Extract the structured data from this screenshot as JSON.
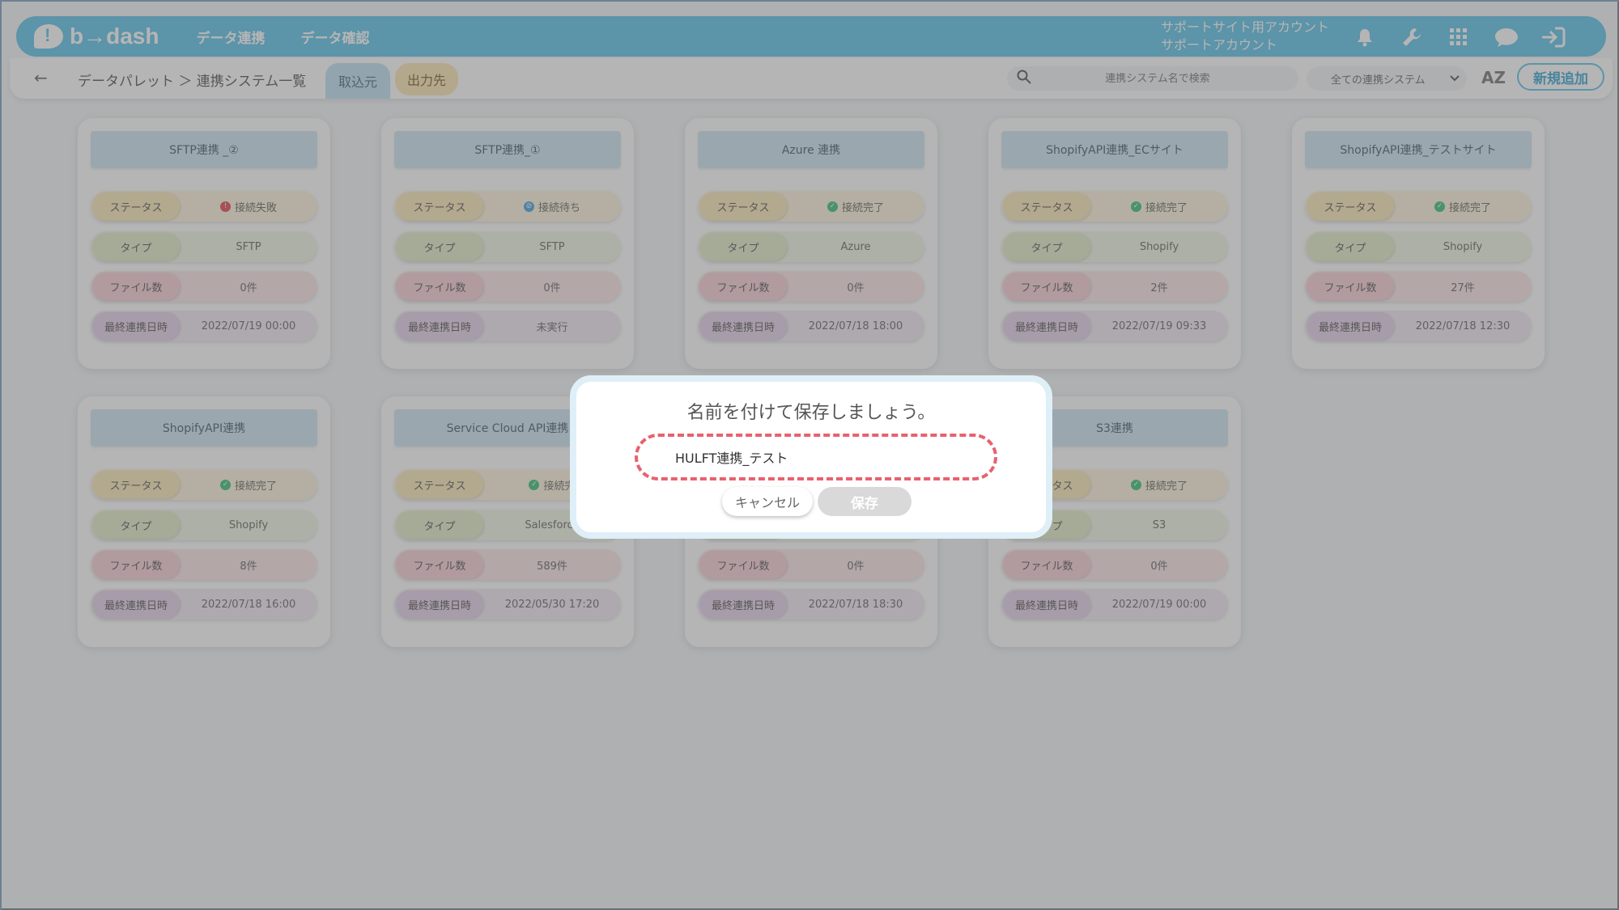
{
  "header": {
    "logo_text": "b→dash",
    "nav": [
      "データ連携",
      "データ確認"
    ],
    "account_line1": "サポートサイト用アカウント",
    "account_line2": "サポートアカウント"
  },
  "subbar": {
    "back_icon": "←",
    "breadcrumb": "データパレット ＞ 連携システム一覧",
    "tab_import": "取込元",
    "tab_export": "出力先",
    "search_placeholder": "連携システム名で検索",
    "filter_value": "全ての連携システム",
    "sort_label": "AZ",
    "add_button": "新規追加"
  },
  "cards": [
    {
      "title": "SFTP連携 _②",
      "status": "接続失敗",
      "status_kind": "fail",
      "type": "SFTP",
      "files": "0件",
      "last": "2022/07/19 00:00"
    },
    {
      "title": "SFTP連携_①",
      "status": "接続待ち",
      "status_kind": "wait",
      "type": "SFTP",
      "files": "0件",
      "last": "未実行"
    },
    {
      "title": "Azure 連携",
      "status": "接続完了",
      "status_kind": "ok",
      "type": "Azure",
      "files": "0件",
      "last": "2022/07/18 18:00"
    },
    {
      "title": "ShopifyAPI連携_ECサイト",
      "status": "接続完了",
      "status_kind": "ok",
      "type": "Shopify",
      "files": "2件",
      "last": "2022/07/19 09:33"
    },
    {
      "title": "ShopifyAPI連携_テストサイト",
      "status": "接続完了",
      "status_kind": "ok",
      "type": "Shopify",
      "files": "27件",
      "last": "2022/07/18 12:30"
    },
    {
      "title": "ShopifyAPI連携",
      "status": "接続完了",
      "status_kind": "ok",
      "type": "Shopify",
      "files": "8件",
      "last": "2022/07/18 16:00"
    },
    {
      "title": "Service Cloud API連携",
      "status": "接続完",
      "status_kind": "ok",
      "type": "Salesforce",
      "files": "589件",
      "last": "2022/05/30 17:20"
    },
    {
      "title": "",
      "status": "",
      "status_kind": "",
      "type": "",
      "files": "0件",
      "last": "2022/07/18 18:30"
    },
    {
      "title": "S3連携",
      "status": "接続完了",
      "status_kind": "ok",
      "type": "S3",
      "files": "0件",
      "last": "2022/07/19 00:00"
    }
  ],
  "labels": {
    "status": "ステータス",
    "type": "タイプ",
    "files": "ファイル数",
    "last": "最終連携日時"
  },
  "modal": {
    "title": "名前を付けて保存しましょう。",
    "input_value": "HULFT連携_テスト",
    "cancel": "キャンセル",
    "save": "保存"
  }
}
